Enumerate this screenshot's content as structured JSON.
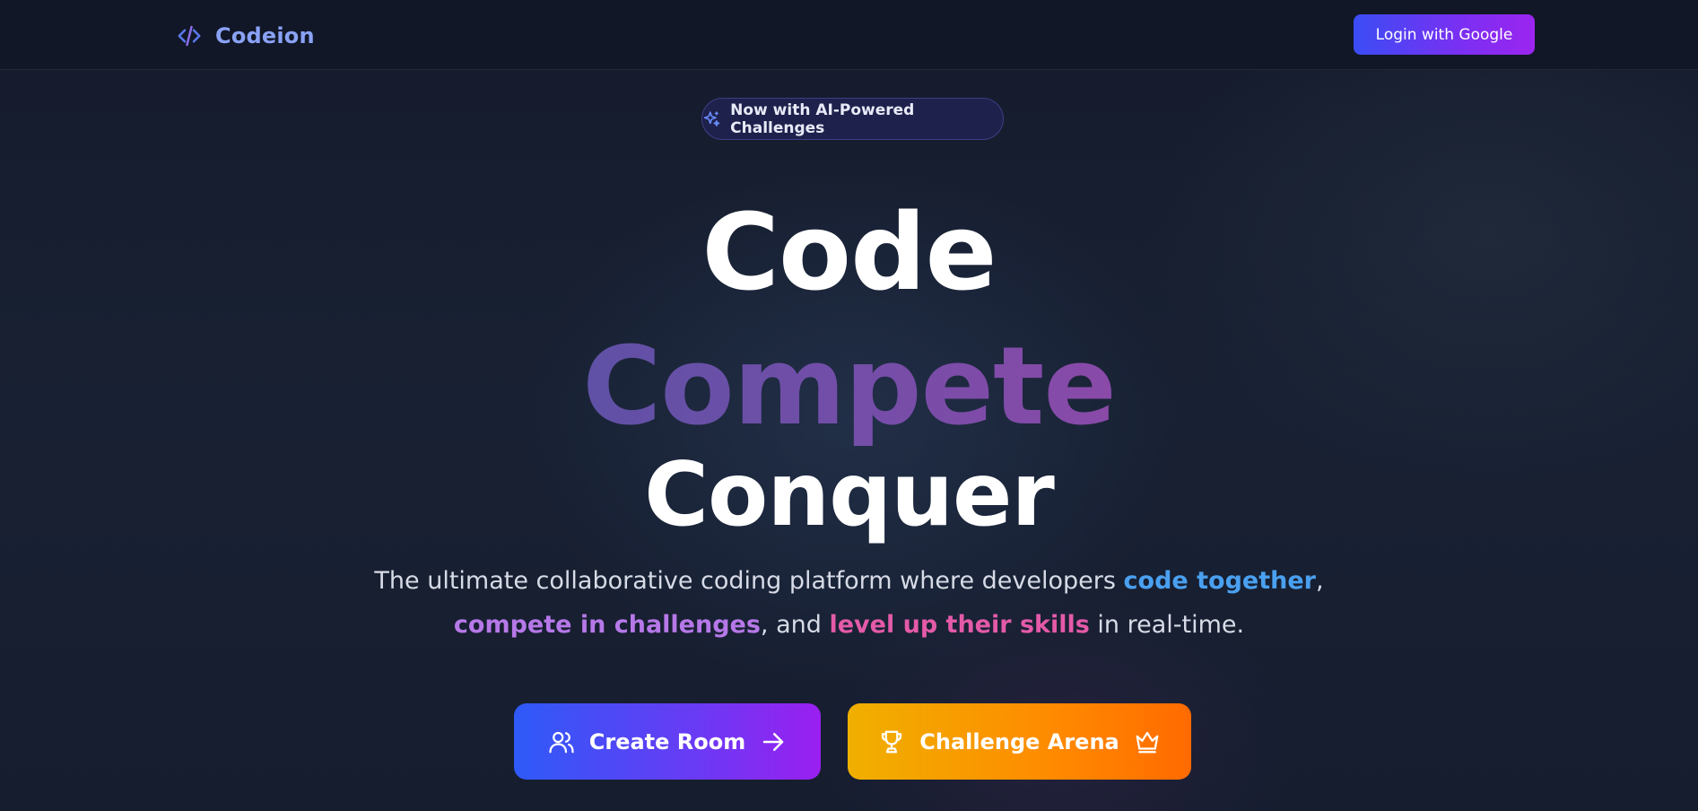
{
  "navbar": {
    "brand_name": "Codeion",
    "brand_icon": "code-brackets-icon",
    "login_label": "Login with Google"
  },
  "badge": {
    "icon": "sparkles-icon",
    "text": "Now with AI-Powered Challenges"
  },
  "hero": {
    "line1": "Code",
    "line2": "Compete",
    "line3": "Conquer"
  },
  "tagline": {
    "part1": "The ultimate collaborative coding platform where developers ",
    "highlight1": "code together",
    "part2": ",",
    "highlight2": "compete in challenges",
    "part3": ", and ",
    "highlight3": "level up their skills",
    "part4": " in real-time."
  },
  "cta": {
    "create_room_label": "Create Room",
    "create_room_icon": "users-icon",
    "create_room_trailing_icon": "arrow-right-icon",
    "challenge_arena_label": "Challenge Arena",
    "challenge_arena_icon": "trophy-icon",
    "challenge_arena_trailing_icon": "crown-icon"
  },
  "colors": {
    "background": "#131a2b",
    "navbar": "#111727",
    "brand_text": "#8aa2f5",
    "highlight_blue": "#4aa0f0",
    "highlight_purple": "#b678e8",
    "highlight_pink": "#e45aa8",
    "compete_purple": "#6d4aa8",
    "primary_gradient_start": "#2e5af8",
    "primary_gradient_end": "#9a1ff0",
    "arena_gradient_start": "#f0b000",
    "arena_gradient_end": "#ff6a00"
  }
}
